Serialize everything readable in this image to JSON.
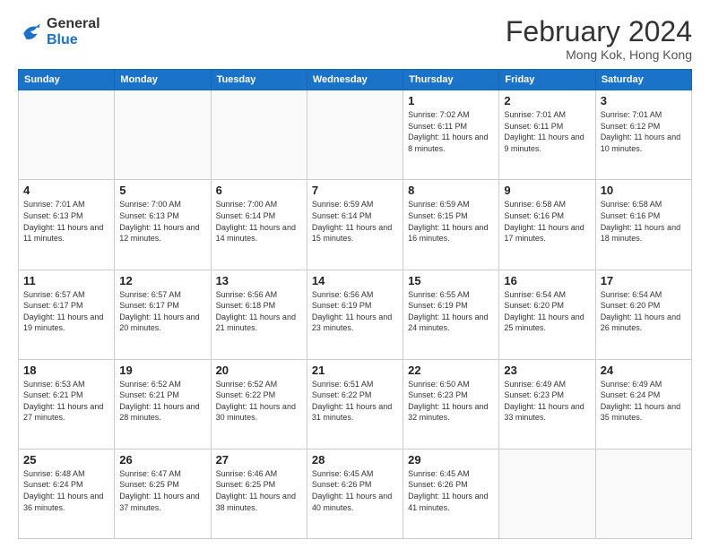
{
  "logo": {
    "line1": "General",
    "line2": "Blue"
  },
  "title": {
    "month_year": "February 2024",
    "location": "Mong Kok, Hong Kong"
  },
  "days_of_week": [
    "Sunday",
    "Monday",
    "Tuesday",
    "Wednesday",
    "Thursday",
    "Friday",
    "Saturday"
  ],
  "weeks": [
    [
      {
        "day": "",
        "info": ""
      },
      {
        "day": "",
        "info": ""
      },
      {
        "day": "",
        "info": ""
      },
      {
        "day": "",
        "info": ""
      },
      {
        "day": "1",
        "info": "Sunrise: 7:02 AM\nSunset: 6:11 PM\nDaylight: 11 hours and 8 minutes."
      },
      {
        "day": "2",
        "info": "Sunrise: 7:01 AM\nSunset: 6:11 PM\nDaylight: 11 hours and 9 minutes."
      },
      {
        "day": "3",
        "info": "Sunrise: 7:01 AM\nSunset: 6:12 PM\nDaylight: 11 hours and 10 minutes."
      }
    ],
    [
      {
        "day": "4",
        "info": "Sunrise: 7:01 AM\nSunset: 6:13 PM\nDaylight: 11 hours and 11 minutes."
      },
      {
        "day": "5",
        "info": "Sunrise: 7:00 AM\nSunset: 6:13 PM\nDaylight: 11 hours and 12 minutes."
      },
      {
        "day": "6",
        "info": "Sunrise: 7:00 AM\nSunset: 6:14 PM\nDaylight: 11 hours and 14 minutes."
      },
      {
        "day": "7",
        "info": "Sunrise: 6:59 AM\nSunset: 6:14 PM\nDaylight: 11 hours and 15 minutes."
      },
      {
        "day": "8",
        "info": "Sunrise: 6:59 AM\nSunset: 6:15 PM\nDaylight: 11 hours and 16 minutes."
      },
      {
        "day": "9",
        "info": "Sunrise: 6:58 AM\nSunset: 6:16 PM\nDaylight: 11 hours and 17 minutes."
      },
      {
        "day": "10",
        "info": "Sunrise: 6:58 AM\nSunset: 6:16 PM\nDaylight: 11 hours and 18 minutes."
      }
    ],
    [
      {
        "day": "11",
        "info": "Sunrise: 6:57 AM\nSunset: 6:17 PM\nDaylight: 11 hours and 19 minutes."
      },
      {
        "day": "12",
        "info": "Sunrise: 6:57 AM\nSunset: 6:17 PM\nDaylight: 11 hours and 20 minutes."
      },
      {
        "day": "13",
        "info": "Sunrise: 6:56 AM\nSunset: 6:18 PM\nDaylight: 11 hours and 21 minutes."
      },
      {
        "day": "14",
        "info": "Sunrise: 6:56 AM\nSunset: 6:19 PM\nDaylight: 11 hours and 23 minutes."
      },
      {
        "day": "15",
        "info": "Sunrise: 6:55 AM\nSunset: 6:19 PM\nDaylight: 11 hours and 24 minutes."
      },
      {
        "day": "16",
        "info": "Sunrise: 6:54 AM\nSunset: 6:20 PM\nDaylight: 11 hours and 25 minutes."
      },
      {
        "day": "17",
        "info": "Sunrise: 6:54 AM\nSunset: 6:20 PM\nDaylight: 11 hours and 26 minutes."
      }
    ],
    [
      {
        "day": "18",
        "info": "Sunrise: 6:53 AM\nSunset: 6:21 PM\nDaylight: 11 hours and 27 minutes."
      },
      {
        "day": "19",
        "info": "Sunrise: 6:52 AM\nSunset: 6:21 PM\nDaylight: 11 hours and 28 minutes."
      },
      {
        "day": "20",
        "info": "Sunrise: 6:52 AM\nSunset: 6:22 PM\nDaylight: 11 hours and 30 minutes."
      },
      {
        "day": "21",
        "info": "Sunrise: 6:51 AM\nSunset: 6:22 PM\nDaylight: 11 hours and 31 minutes."
      },
      {
        "day": "22",
        "info": "Sunrise: 6:50 AM\nSunset: 6:23 PM\nDaylight: 11 hours and 32 minutes."
      },
      {
        "day": "23",
        "info": "Sunrise: 6:49 AM\nSunset: 6:23 PM\nDaylight: 11 hours and 33 minutes."
      },
      {
        "day": "24",
        "info": "Sunrise: 6:49 AM\nSunset: 6:24 PM\nDaylight: 11 hours and 35 minutes."
      }
    ],
    [
      {
        "day": "25",
        "info": "Sunrise: 6:48 AM\nSunset: 6:24 PM\nDaylight: 11 hours and 36 minutes."
      },
      {
        "day": "26",
        "info": "Sunrise: 6:47 AM\nSunset: 6:25 PM\nDaylight: 11 hours and 37 minutes."
      },
      {
        "day": "27",
        "info": "Sunrise: 6:46 AM\nSunset: 6:25 PM\nDaylight: 11 hours and 38 minutes."
      },
      {
        "day": "28",
        "info": "Sunrise: 6:45 AM\nSunset: 6:26 PM\nDaylight: 11 hours and 40 minutes."
      },
      {
        "day": "29",
        "info": "Sunrise: 6:45 AM\nSunset: 6:26 PM\nDaylight: 11 hours and 41 minutes."
      },
      {
        "day": "",
        "info": ""
      },
      {
        "day": "",
        "info": ""
      }
    ]
  ]
}
